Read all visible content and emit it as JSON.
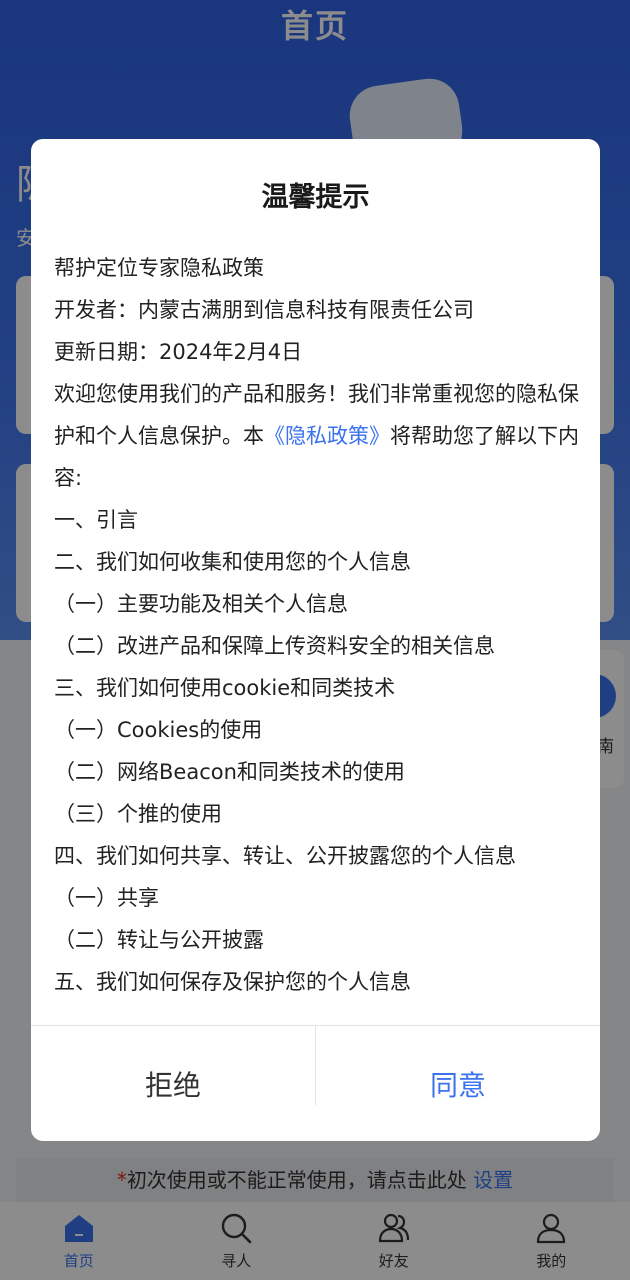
{
  "header": {
    "title": "首页"
  },
  "hero": {
    "text1": "隐",
    "text2": "安"
  },
  "side_card": {
    "label": "指南"
  },
  "notice": {
    "star": "*",
    "text": "初次使用或不能正常使用，请点击此处",
    "link": "设置"
  },
  "tabbar": [
    {
      "label": "首页",
      "icon": "home-icon",
      "active": true
    },
    {
      "label": "寻人",
      "icon": "search-icon",
      "active": false
    },
    {
      "label": "好友",
      "icon": "friends-icon",
      "active": false
    },
    {
      "label": "我的",
      "icon": "user-icon",
      "active": false
    }
  ],
  "dialog": {
    "title": "温馨提示",
    "line1": "帮护定位专家隐私政策",
    "line2": "开发者：内蒙古满朋到信息科技有限责任公司",
    "line3": "更新日期：2024年2月4日",
    "intro_pre": "欢迎您使用我们的产品和服务！我们非常重视您的隐私保护和个人信息保护。本",
    "intro_link": "《隐私政策》",
    "intro_post": "将帮助您了解以下内容:",
    "toc": [
      "一、引言",
      "二、我们如何收集和使用您的个人信息",
      "（一）主要功能及相关个人信息",
      "（二）改进产品和保障上传资料安全的相关信息",
      "三、我们如何使用cookie和同类技术",
      "（一）Cookies的使用",
      "（二）网络Beacon和同类技术的使用",
      "（三）个推的使用",
      "四、我们如何共享、转让、公开披露您的个人信息",
      "（一）共享",
      "（二）转让与公开披露",
      "五、我们如何保存及保护您的个人信息"
    ],
    "reject_label": "拒绝",
    "agree_label": "同意"
  },
  "colors": {
    "primary": "#3b73ee",
    "alert": "#e0271f"
  }
}
